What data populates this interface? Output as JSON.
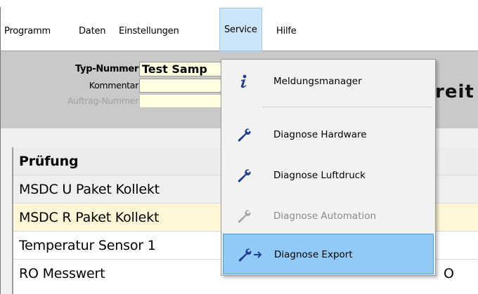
{
  "menubar": {
    "items": [
      "Programm",
      "Daten",
      "Einstellungen",
      "Service",
      "Hilfe"
    ],
    "active": "Service"
  },
  "header": {
    "type_label": "Typ-Nummer",
    "type_value": "Test Samp",
    "comment_label": "Kommentar",
    "comment_value": "",
    "order_label": "Auftrag-Nummer",
    "order_value": "",
    "status_text": "reit"
  },
  "table": {
    "header": "Prüfung",
    "rows": [
      "MSDC U Paket Kollekt",
      "MSDC R Paket Kollekt",
      "Temperatur Sensor 1",
      "RO Messwert"
    ],
    "partial_value": "O"
  },
  "service_menu": {
    "items": [
      {
        "label": "Meldungsmanager",
        "icon": "info-icon",
        "disabled": false
      },
      {
        "label": "Diagnose Hardware",
        "icon": "wrench-icon",
        "disabled": false
      },
      {
        "label": "Diagnose Luftdruck",
        "icon": "wrench-icon",
        "disabled": false
      },
      {
        "label": "Diagnose Automation",
        "icon": "wrench-icon",
        "disabled": true
      },
      {
        "label": "Diagnose Export",
        "icon": "wrench-arrow-icon",
        "disabled": false
      }
    ],
    "highlighted": "Diagnose Export"
  },
  "colors": {
    "menu_active_bg": "#cce4f7",
    "highlight_bg": "#91c9f7",
    "input_bg": "#ffffe1",
    "row_alt_bg": "#fff6d5",
    "icon_blue": "#1f3f8f"
  }
}
